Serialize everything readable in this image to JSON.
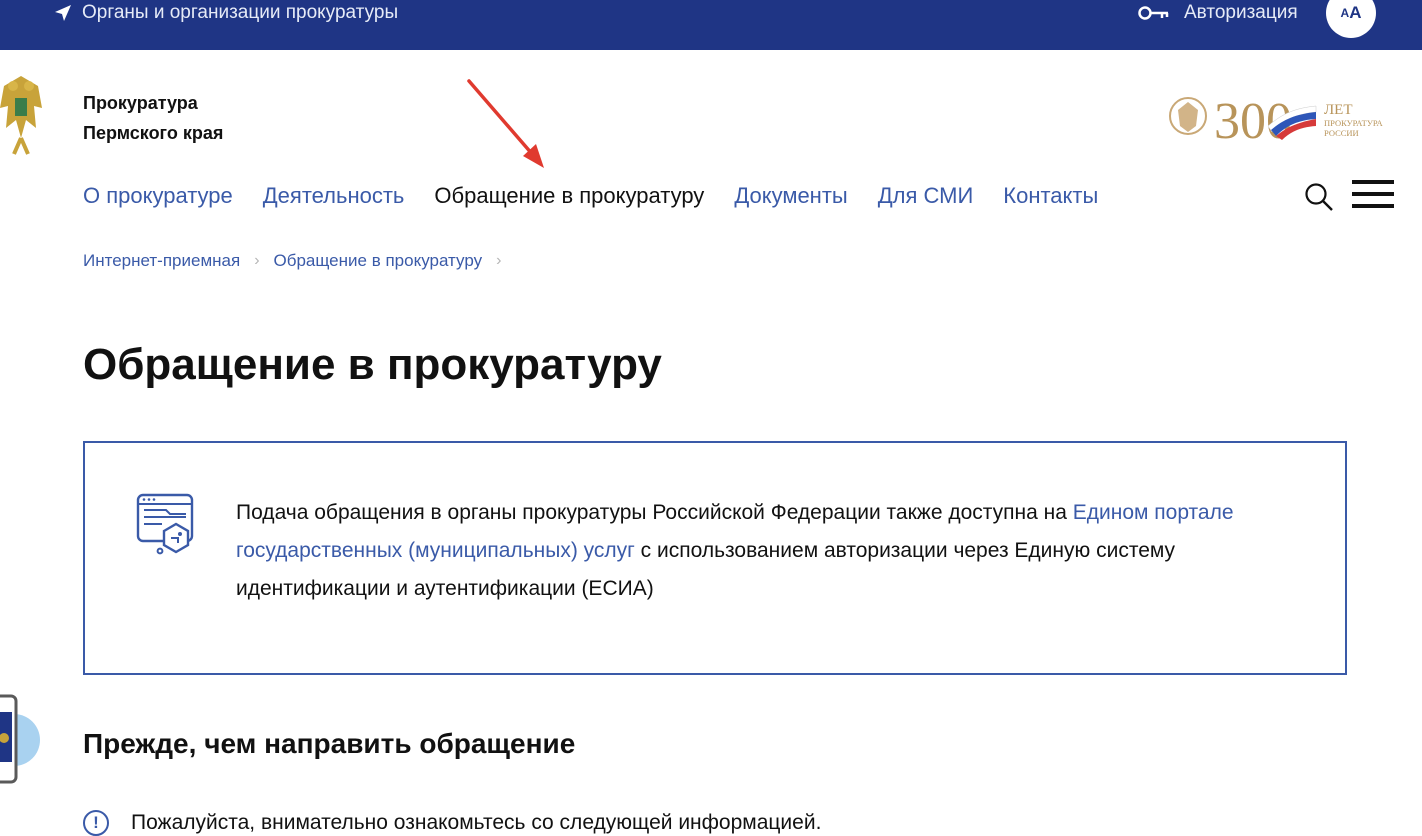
{
  "topbar": {
    "orgs_label": "Органы и организации прокуратуры",
    "auth_label": "Авторизация",
    "font_small": "А",
    "font_big": "А",
    "bg_color": "#1f3585"
  },
  "header": {
    "org_line1": "Прокуратура",
    "org_line2": "Пермского края",
    "anniversary": {
      "number": "300",
      "word": "ЛЕТ",
      "line1": "ПРОКУРАТУРА",
      "line2": "РОССИИ"
    }
  },
  "nav": {
    "items": [
      {
        "label": "О прокуратуре"
      },
      {
        "label": "Деятельность"
      },
      {
        "label": "Обращение в прокуратуру"
      },
      {
        "label": "Документы"
      },
      {
        "label": "Для СМИ"
      },
      {
        "label": "Контакты"
      }
    ],
    "active_index": 2
  },
  "breadcrumb": {
    "items": [
      {
        "label": "Интернет-приемная"
      },
      {
        "label": "Обращение в прокуратуру"
      }
    ]
  },
  "page": {
    "title": "Обращение в прокуратуру",
    "info": {
      "text_before": "Подача обращения в органы прокуратуры Российской Федерации также доступна на ",
      "link": "Едином портале государственных (муниципальных) услуг",
      "text_after": " с использованием авторизации через Единую систему идентификации и аутентификации (ЕСИА)"
    },
    "subheading": "Прежде, чем направить обращение",
    "notice_mark": "!",
    "notice": "Пожалуйста, внимательно ознакомьтесь со следующей информацией."
  },
  "colors": {
    "accent": "#3a5aa8",
    "annotation_arrow": "#e03a2f",
    "gold": "#b8945a"
  }
}
